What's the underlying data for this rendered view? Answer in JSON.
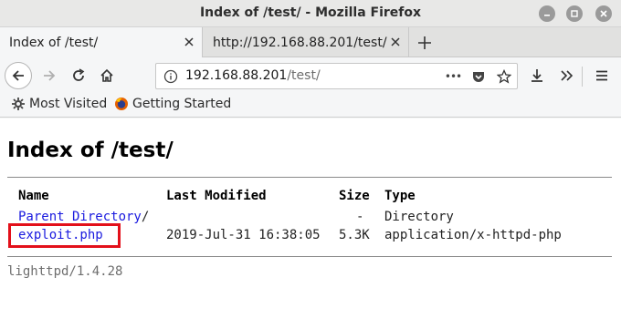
{
  "window": {
    "title": "Index of /test/ - Mozilla Firefox"
  },
  "tabs": [
    {
      "label": "Index of /test/",
      "active": true
    },
    {
      "label": "http://192.168.88.201/test/",
      "active": false
    }
  ],
  "navbar": {
    "url_host": "192.168.88.201",
    "url_path": "/test/",
    "more_actions_label": "•••"
  },
  "bookmarks": [
    {
      "label": "Most Visited",
      "icon": "gear-icon"
    },
    {
      "label": "Getting Started",
      "icon": "firefox-icon"
    }
  ],
  "page": {
    "heading": "Index of /test/",
    "columns": {
      "name": "Name",
      "last_modified": "Last Modified",
      "size": "Size",
      "type": "Type"
    },
    "rows": [
      {
        "name": "Parent Directory",
        "suffix": "/",
        "last_modified": "",
        "size": "-",
        "type": "Directory"
      },
      {
        "name": "exploit.php",
        "suffix": "",
        "last_modified": "2019-Jul-31 16:38:05",
        "size": "5.3K",
        "type": "application/x-httpd-php"
      }
    ],
    "footer": "lighttpd/1.4.28"
  },
  "colors": {
    "link": "#1a1adf",
    "highlight_box": "#e3101a"
  }
}
